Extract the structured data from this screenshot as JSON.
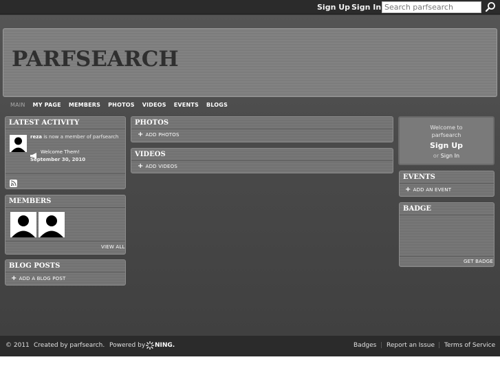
{
  "topbar": {
    "signup_label": "Sign Up",
    "signin_label": "Sign In",
    "search_placeholder": "Search parfsearch"
  },
  "site": {
    "title": "PARFSEARCH"
  },
  "nav": {
    "items": [
      "MAIN",
      "MY PAGE",
      "MEMBERS",
      "PHOTOS",
      "VIDEOS",
      "EVENTS",
      "BLOGS"
    ]
  },
  "latest_activity": {
    "title": "LATEST ACTIVITY",
    "member_name": "reza",
    "member_text": "is now a member of parfsearch",
    "welcome_label": "Welcome Them!",
    "date": "September 30, 2010"
  },
  "members": {
    "title": "MEMBERS",
    "view_all_label": "VIEW ALL"
  },
  "blog_posts": {
    "title": "BLOG POSTS",
    "add_label": "ADD A BLOG POST"
  },
  "photos": {
    "title": "PHOTOS",
    "add_label": "ADD PHOTOS"
  },
  "videos": {
    "title": "VIDEOS",
    "add_label": "ADD VIDEOS"
  },
  "welcome_box": {
    "welcome_line1": "Welcome to",
    "welcome_line2": "parfsearch",
    "signup_label": "Sign Up",
    "or_text": "or",
    "signin_label": "Sign In"
  },
  "events": {
    "title": "EVENTS",
    "add_label": "ADD AN EVENT"
  },
  "badge": {
    "title": "BADGE",
    "get_badge_label": "GET BADGE"
  },
  "footer": {
    "copyright": "© 2011",
    "created_by": "Created by parfsearch.",
    "powered_by": "Powered by",
    "ning_label": "NING.",
    "badges_label": "Badges",
    "report_label": "Report an Issue",
    "terms_label": "Terms of Service"
  }
}
